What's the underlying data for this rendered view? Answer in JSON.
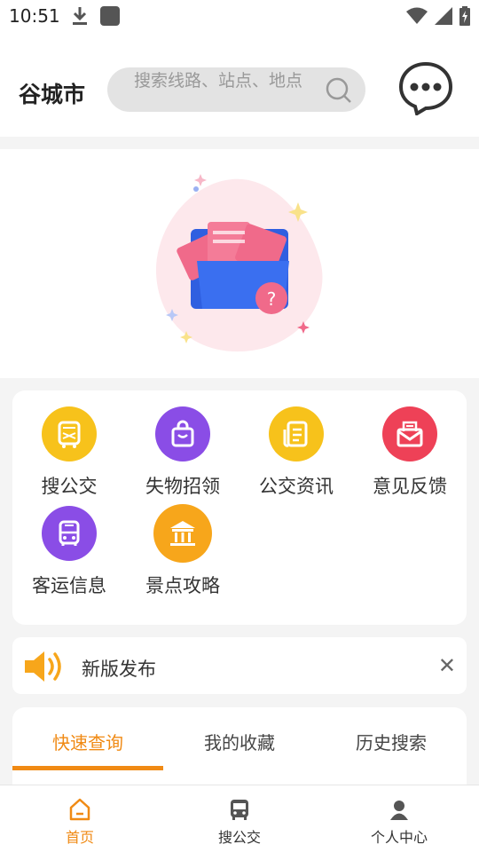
{
  "status_bar": {
    "time": "10:51"
  },
  "header": {
    "city": "谷城市",
    "search_placeholder": "搜索线路、站点、地点"
  },
  "quick_grid": [
    {
      "label": "搜公交",
      "icon": "bus-ticket-icon",
      "color": "#f7c21b"
    },
    {
      "label": "失物招领",
      "icon": "shopping-bag-icon",
      "color": "#8a4de6"
    },
    {
      "label": "公交资讯",
      "icon": "news-icon",
      "color": "#f7c21b"
    },
    {
      "label": "意见反馈",
      "icon": "mail-icon",
      "color": "#ee4157"
    },
    {
      "label": "客运信息",
      "icon": "bus-icon",
      "color": "#8a4de6"
    },
    {
      "label": "景点攻略",
      "icon": "temple-icon",
      "color": "#f7a61b"
    }
  ],
  "notice": {
    "text": "新版发布",
    "close_symbol": "✕"
  },
  "tabs": [
    {
      "label": "快速查询",
      "active": true
    },
    {
      "label": "我的收藏",
      "active": false
    },
    {
      "label": "历史搜索",
      "active": false
    }
  ],
  "bottom_nav": [
    {
      "label": "首页",
      "icon": "home-icon",
      "active": true
    },
    {
      "label": "搜公交",
      "icon": "bus-icon",
      "active": false
    },
    {
      "label": "个人中心",
      "icon": "person-icon",
      "active": false
    }
  ],
  "colors": {
    "accent": "#f08a14",
    "background": "#f4f4f4"
  }
}
